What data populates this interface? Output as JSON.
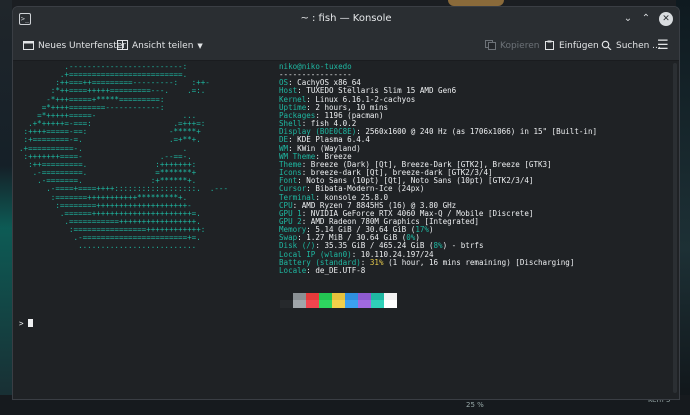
{
  "window": {
    "title": "~ : fish — Konsole"
  },
  "toolbar": {
    "new_tab": "Neues Unterfenster",
    "split_view": "Ansicht teilen",
    "copy": "Kopieren",
    "paste": "Einfügen",
    "find": "Suchen ..."
  },
  "desktop": {
    "label_right": "Kern 5",
    "label_bottom": "25 %"
  },
  "terminal": {
    "user_host": "niko@niko-tuxedo",
    "separator": "----------------",
    "info": [
      {
        "key": "OS",
        "value": ": CachyOS x86_64"
      },
      {
        "key": "Host",
        "value": ": TUXEDO Stellaris Slim 15 AMD Gen6"
      },
      {
        "key": "Kernel",
        "value": ": Linux 6.16.1-2-cachyos"
      },
      {
        "key": "Uptime",
        "value": ": 2 hours, 10 mins"
      },
      {
        "key": "Packages",
        "value": ": 1196 (pacman)"
      },
      {
        "key": "Shell",
        "value": ": fish 4.0.2"
      },
      {
        "key": "Display (BOE0C8E)",
        "value": ": 2560x1600 @ 240 Hz (as 1706x1066) in 15\" [Built-in]"
      },
      {
        "key": "DE",
        "value": ": KDE Plasma 6.4.4"
      },
      {
        "key": "WM",
        "value": ": KWin (Wayland)"
      },
      {
        "key": "WM Theme",
        "value": ": Breeze"
      },
      {
        "key": "Theme",
        "value": ": Breeze (Dark) [Qt], Breeze-Dark [GTK2], Breeze [GTK3]"
      },
      {
        "key": "Icons",
        "value": ": breeze-dark [Qt], breeze-dark [GTK2/3/4]"
      },
      {
        "key": "Font",
        "value": ": Noto Sans (10pt) [Qt], Noto Sans (10pt) [GTK2/3/4]"
      },
      {
        "key": "Cursor",
        "value": ": Bibata-Modern-Ice (24px)"
      },
      {
        "key": "Terminal",
        "value": ": konsole 25.8.0"
      },
      {
        "key": "CPU",
        "value": ": AMD Ryzen 7 8845HS (16) @ 3.80 GHz"
      },
      {
        "key": "GPU 1",
        "value": ": NVIDIA GeForce RTX 4060 Max-Q / Mobile [Discrete]"
      },
      {
        "key": "GPU 2",
        "value": ": AMD Radeon 780M Graphics [Integrated]"
      },
      {
        "key": "Memory",
        "value": ": 5.14 GiB / 30.64 GiB (",
        "pct": "17%",
        "tail": ")"
      },
      {
        "key": "Swap",
        "value": ": 1.27 MiB / 30.64 GiB (",
        "pct": "0%",
        "tail": ")"
      },
      {
        "key": "Disk (/)",
        "value": ": 35.35 GiB / 465.24 GiB (",
        "pct": "8%",
        "tail": ") - btrfs"
      },
      {
        "key": "Local IP (wlan0)",
        "value": ": 10.110.24.197/24"
      },
      {
        "key": "Battery (standard)",
        "value": ": ",
        "pct": "31%",
        "tail": " (1 hour, 16 mins remaining) [Discharging]"
      },
      {
        "key": "Locale",
        "value": ": de_DE.UTF-8"
      }
    ],
    "palette_row1": [
      "#1f2225",
      "#8a9094",
      "#e43a3a",
      "#23c552",
      "#e6c23c",
      "#2f8fdf",
      "#8e5bd0",
      "#1fb8a2",
      "#f2f2f2"
    ],
    "palette_row2": [
      "#26292c",
      "#a0a6aa",
      "#f0454f",
      "#2ed55f",
      "#f2d04a",
      "#3ba0f0",
      "#a06ae0",
      "#2fd0b8",
      "#ffffff"
    ],
    "prompt_symbol": ">"
  },
  "logo_lines": [
    "          .-------------------------:",
    "         .+=========================.",
    "        :++===++=========---------:   :++-",
    "       :*++====+++++=========---.    .=:.",
    "      -*+++=====+*****=========:",
    "     =*++++========------------:",
    "    =*+++++=====-                   ...",
    "  .+*+++++=-===:                  .=+++=:",
    " :++++=====-==:                  -*****+",
    " :+========-=.                   .=+**+.",
    ".+==========-.                      .",
    " :+++++++====-                 .--==-.",
    "  :++=========.               :+++++++:",
    "   .-=========.               =*******+",
    "    .-=======.               :+******+.",
    "      .-====+====++++::::::::::::::::::.  .---",
    "       :=======+++++++++++*********+.",
    "        :========++++++++++++++++++++-",
    "         .======++++++++++++++++++++++=.",
    "          .===========+++++++++++++++++.",
    "           :================++++++++++++:",
    "            .-=======================+=.",
    "             .........................."
  ]
}
